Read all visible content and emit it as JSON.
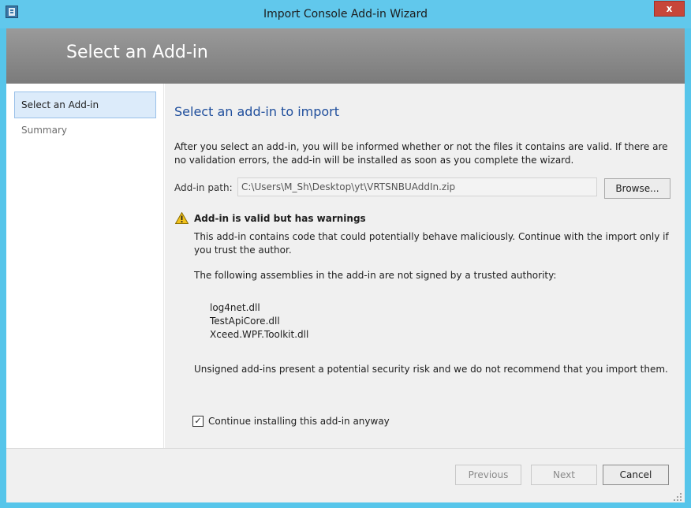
{
  "window": {
    "title": "Import Console Add-in Wizard",
    "close_glyph": "x",
    "accent_color": "#61c8ec"
  },
  "banner": {
    "title": "Select an Add-in"
  },
  "sidebar": {
    "items": [
      {
        "label": "Select an Add-in",
        "active": true
      },
      {
        "label": "Summary",
        "active": false
      }
    ]
  },
  "main": {
    "heading": "Select an add-in to import",
    "intro": "After you select an add-in, you will be informed whether or not the files it contains are valid. If there are no validation errors, the add-in will be installed as soon as you complete the wizard.",
    "path_label": "Add-in path:",
    "path_value": "C:\\Users\\M_Sh\\Desktop\\yt\\VRTSNBUAddIn.zip",
    "browse_label": "Browse...",
    "warning": {
      "icon": "warning-icon",
      "title": "Add-in is valid but has warnings",
      "body": "This add-in contains code that could potentially behave maliciously. Continue with the import only if you trust the author.",
      "assemblies_heading": "The following assemblies in the add-in are not signed by a trusted authority:",
      "assemblies": [
        "log4net.dll",
        "TestApiCore.dll",
        "Xceed.WPF.Toolkit.dll"
      ],
      "risk_text": "Unsigned add-ins present a potential security risk and we do not recommend that you import them."
    },
    "continue_checkbox": {
      "label": "Continue installing this add-in anyway",
      "checked": true,
      "mark": "✓"
    }
  },
  "footer": {
    "previous_label": "Previous",
    "next_label": "Next",
    "cancel_label": "Cancel"
  }
}
